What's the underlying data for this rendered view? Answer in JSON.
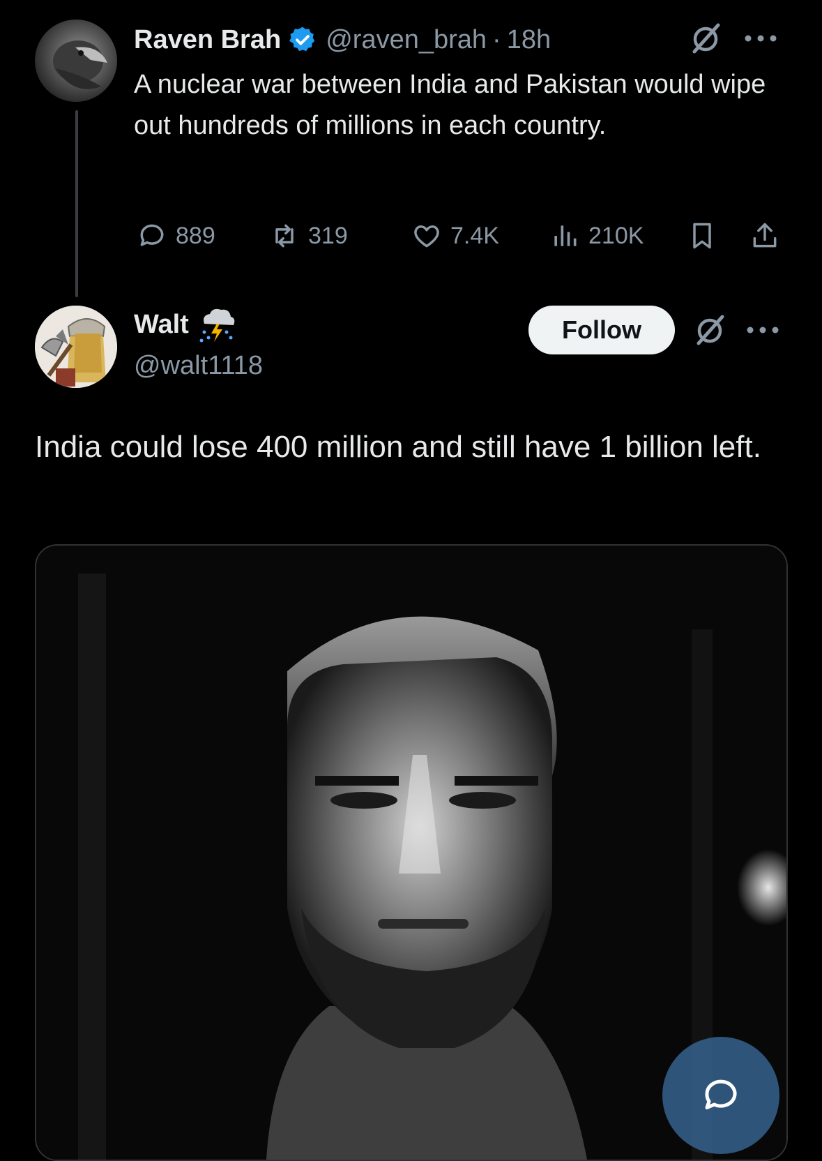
{
  "tweet": {
    "author_name": "Raven Brah",
    "verified_icon": "verified-badge-icon",
    "handle": "@raven_brah",
    "separator": "·",
    "time": "18h",
    "text": "A nuclear war between India and Pakistan would wipe out hundreds of millions in each country.",
    "actions": {
      "replies": "889",
      "reposts": "319",
      "likes": "7.4K",
      "views": "210K"
    }
  },
  "reply": {
    "author_name": "Walt",
    "emoji_icon": "storm-cloud-icon",
    "handle": "@walt1118",
    "follow_label": "Follow",
    "text": "India could lose 400 million and still have 1 billion left."
  },
  "colors": {
    "background": "#000000",
    "text_primary": "#e7e9ea",
    "text_secondary": "#8b98a5",
    "verified_blue": "#1d9bf0",
    "follow_bg": "#eff3f4"
  }
}
